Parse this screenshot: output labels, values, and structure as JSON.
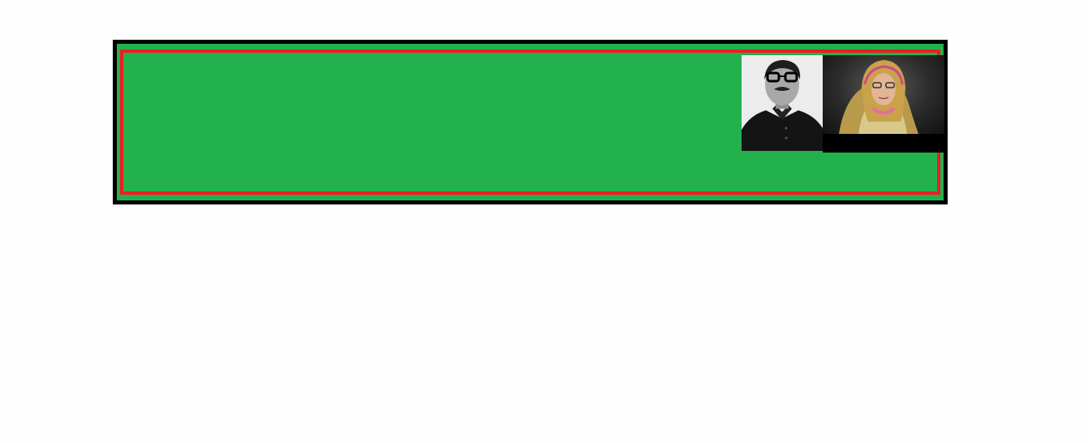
{
  "banner": {
    "colors": {
      "outer_border": "#000000",
      "band": "#23b14d",
      "frame": "#ed1c24"
    },
    "photos": [
      {
        "name": "portrait-man",
        "style": "black-and-white"
      },
      {
        "name": "portrait-woman",
        "style": "color"
      }
    ]
  }
}
